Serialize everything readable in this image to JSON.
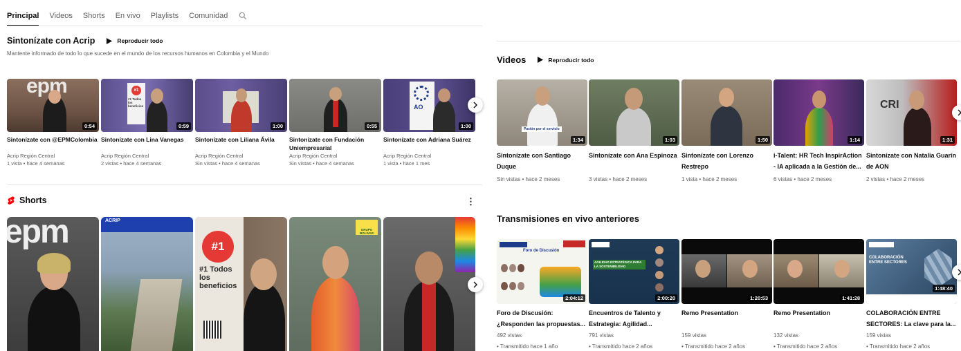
{
  "tabs": [
    "Principal",
    "Videos",
    "Shorts",
    "En vivo",
    "Playlists",
    "Comunidad"
  ],
  "playlist": {
    "title": "Sintonízate con Acrip",
    "play_all": "Reproducir todo",
    "description": "Mantente informado de todo lo que sucede en el mundo de los recursos humanos en Colombia y el Mundo",
    "videos": [
      {
        "title": "Sintonízate con @EPMColombia",
        "channel": "Acrip Región Central",
        "stats": "1 vista • hace 4 semanas",
        "duration": "0:54",
        "thumb_text": "epm"
      },
      {
        "title": "Sintonízate con Lina Vanegas",
        "channel": "Acrip Región Central",
        "stats": "2 vistas • hace 4 semanas",
        "duration": "0:59",
        "thumb_text": "#1 Todos los beneficios"
      },
      {
        "title": "Sintonízate con Liliana Ávila",
        "channel": "Acrip Región Central",
        "stats": "Sin vistas • hace 4 semanas",
        "duration": "1:00",
        "thumb_text": ""
      },
      {
        "title": "Sintonízate con Fundación Uniempresarial",
        "channel": "Acrip Región Central",
        "stats": "Sin vistas • hace 4 semanas",
        "duration": "0:55",
        "thumb_text": ""
      },
      {
        "title": "Sintonízate con Adriana Suárez",
        "channel": "Acrip Región Central",
        "stats": "1 vista • hace 1 mes",
        "duration": "1:00",
        "thumb_text": "AO"
      }
    ]
  },
  "shorts": {
    "title": "Shorts",
    "items": [
      {
        "text": "epm"
      },
      {
        "text": "ACRIP"
      },
      {
        "text": "#1 Todos los beneficios"
      },
      {
        "text": "GRUPO BOLÍVAR"
      },
      {
        "text": ""
      }
    ]
  },
  "videos_section": {
    "title": "Videos",
    "play_all": "Reproducir todo",
    "items": [
      {
        "title": "Sintonízate con Santiago Duque",
        "stats": "Sin vistas • hace 2 meses",
        "duration": "1:34",
        "thumb_text": "Pasión por el servicio"
      },
      {
        "title": "Sintonízate con Ana Espinoza",
        "stats": "3 vistas • hace 2 meses",
        "duration": "1:03",
        "thumb_text": ""
      },
      {
        "title": "Sintonízate con Lorenzo Restrepo",
        "stats": "1 vista • hace 2 meses",
        "duration": "1:50",
        "thumb_text": ""
      },
      {
        "title": "i-Talent: HR Tech InspirAction - IA aplicada a la Gestión de...",
        "stats": "6 vistas • hace 2 meses",
        "duration": "1:14",
        "thumb_text": ""
      },
      {
        "title": "Sintonízate con Natalia Guarín de AON",
        "stats": "2 vistas • hace 2 meses",
        "duration": "1:31",
        "thumb_text": "CRI"
      }
    ]
  },
  "live_section": {
    "title": "Transmisiones en vivo anteriores",
    "items": [
      {
        "title": "Foro de Discusión: ¿Responden las propuestas...",
        "views": "492 vistas",
        "when": "• Transmitido hace 1 año",
        "duration": "2:04:12",
        "thumb_text": "Foro de Discusión"
      },
      {
        "title": "Encuentros de Talento y Estrategia: Agilidad...",
        "views": "791 vistas",
        "when": "• Transmitido hace 2 años",
        "duration": "2:00:20",
        "thumb_text": "AGILIDAD ESTRATÉGICA PARA LA SOSTENIBILIDAD"
      },
      {
        "title": "Remo Presentation",
        "views": "159 vistas",
        "when": "• Transmitido hace 2 años",
        "duration": "1:20:53",
        "thumb_text": ""
      },
      {
        "title": "Remo Presentation",
        "views": "132 vistas",
        "when": "• Transmitido hace 2 años",
        "duration": "1:41:28",
        "thumb_text": ""
      },
      {
        "title": "COLABORACIÓN ENTRE SECTORES: La clave para la...",
        "views": "159 vistas",
        "when": "• Transmitido hace 2 años",
        "duration": "1:48:40",
        "thumb_text": "COLABORACIÓN ENTRE SECTORES"
      }
    ]
  },
  "colors": {
    "text": "#0f0f0f",
    "secondary": "#606060",
    "shorts_red": "#ff0000"
  }
}
